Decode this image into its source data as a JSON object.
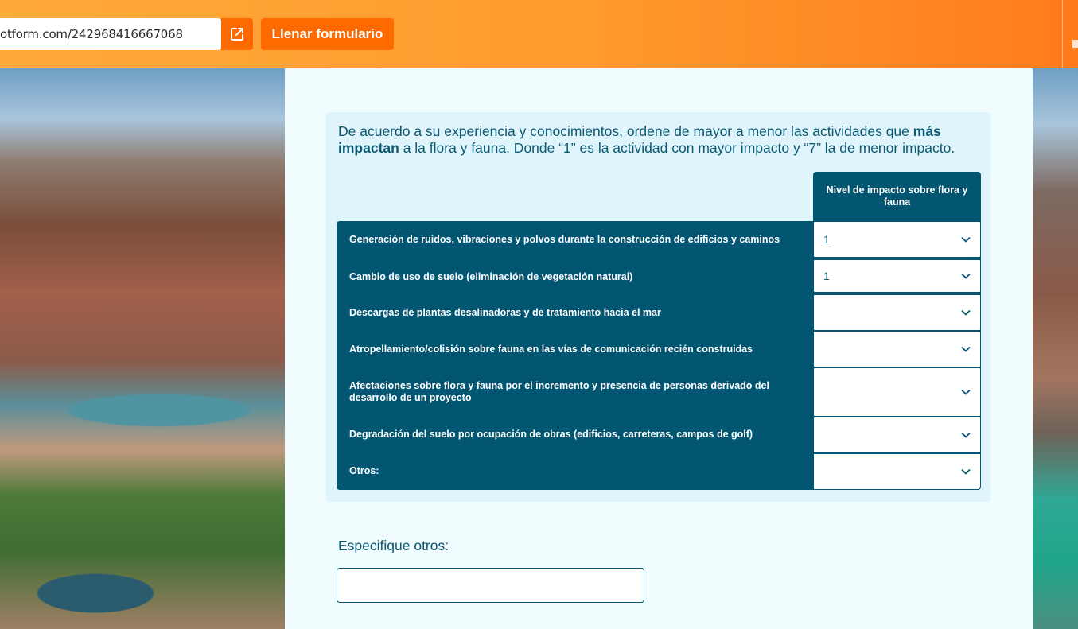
{
  "topbar": {
    "url": "otform.com/242968416667068",
    "fill_button": "Llenar formulario"
  },
  "question": {
    "text_before": "De acuerdo a su experiencia y conocimientos, ordene de mayor a menor las actividades que ",
    "text_bold": "más impactan",
    "text_after": " a la flora y fauna. Donde “1” es la actividad con mayor impacto y “7” la de menor impacto.",
    "column_header": "Nivel de impacto sobre flora y fauna",
    "rows": [
      {
        "label": "Generación de ruidos, vibraciones y polvos durante la construcción de edificios y caminos",
        "value": "1"
      },
      {
        "label": "Cambio de uso de suelo (eliminación de vegetación natural)",
        "value": "1"
      },
      {
        "label": "Descargas de plantas desalinadoras y de tratamiento hacia el mar",
        "value": ""
      },
      {
        "label": "Atropellamiento/colisión sobre fauna en las vías de comunicación recién construidas",
        "value": ""
      },
      {
        "label": "Afectaciones sobre flora y fauna por el incremento y presencia de personas derivado del desarrollo de un proyecto",
        "value": ""
      },
      {
        "label": "Degradación del suelo por ocupación de obras (edificios, carreteras, campos de golf)",
        "value": ""
      },
      {
        "label": "Otros:",
        "value": ""
      }
    ]
  },
  "other": {
    "label": "Especifique otros:",
    "value": ""
  },
  "colors": {
    "accent": "#ff6a00",
    "primary": "#035672",
    "text": "#0b5a73"
  }
}
